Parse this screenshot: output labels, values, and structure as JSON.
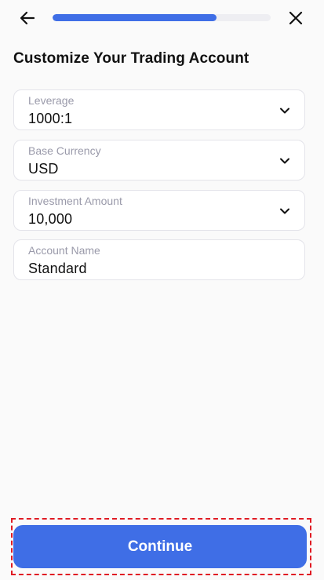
{
  "header": {
    "back_icon": "arrow-left-icon",
    "close_icon": "close-icon",
    "progress_fraction": 0.75
  },
  "page": {
    "title": "Customize Your Trading Account"
  },
  "fields": {
    "leverage": {
      "label": "Leverage",
      "value": "1000:1",
      "icon": "chevron-down-icon"
    },
    "base_currency": {
      "label": "Base Currency",
      "value": "USD",
      "icon": "chevron-down-icon"
    },
    "investment_amount": {
      "label": "Investment Amount",
      "value": "10,000",
      "icon": "chevron-down-icon"
    },
    "account_name": {
      "label": "Account Name",
      "value": "Standard"
    }
  },
  "footer": {
    "continue_label": "Continue"
  },
  "colors": {
    "accent": "#3f6ee6",
    "highlight": "#e01b24"
  }
}
